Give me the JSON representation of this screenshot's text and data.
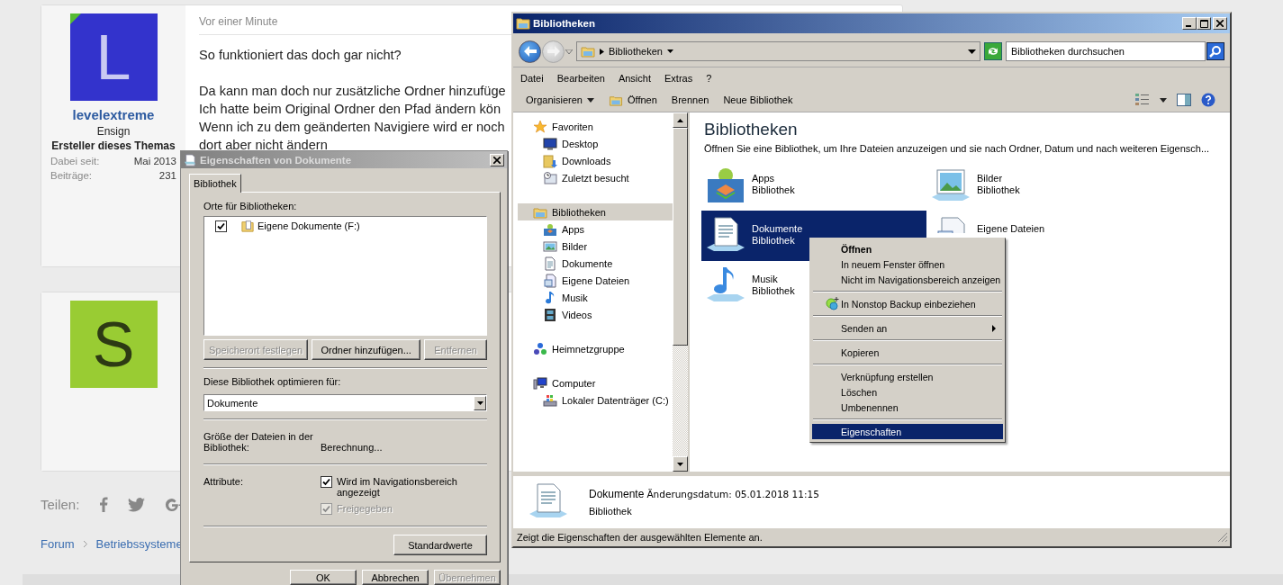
{
  "forum": {
    "posts": [
      {
        "avatar": {
          "letter": "L",
          "color": "#3333cc",
          "badge": true
        },
        "author": "levelextreme",
        "rank": "Ensign",
        "role": "Ersteller dieses Themas",
        "stats": [
          {
            "label": "Dabei seit:",
            "value": "Mai 2013"
          },
          {
            "label": "Beiträge:",
            "value": "231"
          }
        ],
        "time": "Vor einer Minute",
        "paragraphs": [
          [
            "So funktioniert das doch gar nicht?"
          ],
          [
            "Da kann man doch nur zusätzliche Ordner hinzufüge",
            "Ich hatte beim Original Ordner den Pfad ändern kön",
            "Wenn ich zu dem geänderten Navigiere wird er noch",
            "dort aber nicht ändern"
          ]
        ]
      },
      {
        "avatar": {
          "letter": "S",
          "color": "#99cc33",
          "badge": false
        }
      }
    ],
    "share": {
      "label": "Teilen:"
    },
    "breadcrumb": [
      "Forum",
      "Betriebssysteme"
    ]
  },
  "properties_dialog": {
    "title": "Eigenschaften von Dokumente",
    "tabs": [
      {
        "label": "Bibliothek",
        "selected": true
      }
    ],
    "locations_label": "Orte für Bibliotheken:",
    "locations": [
      {
        "name": "Eigene Dokumente (F:)",
        "checked": true
      }
    ],
    "location_buttons": [
      {
        "label": "Speicherort festlegen",
        "disabled": true
      },
      {
        "label": "Ordner hinzufügen...",
        "disabled": false
      },
      {
        "label": "Entfernen",
        "disabled": true
      }
    ],
    "optimize_label": "Diese Bibliothek optimieren für:",
    "optimize_value": "Dokumente",
    "size_label": "Größe der Dateien in der Bibliothek:",
    "size_value": "Berechnung...",
    "attributes_label": "Attribute:",
    "attributes": [
      {
        "label": "Wird im Navigationsbereich angezeigt",
        "checked": true,
        "disabled": false
      },
      {
        "label": "Freigegeben",
        "checked": true,
        "disabled": true
      }
    ],
    "defaults_button": "Standardwerte",
    "buttons": [
      {
        "label": "OK",
        "disabled": false
      },
      {
        "label": "Abbrechen",
        "disabled": false
      },
      {
        "label": "Übernehmen",
        "disabled": true
      }
    ]
  },
  "explorer": {
    "title": "Bibliotheken",
    "address": [
      "Bibliotheken"
    ],
    "search": {
      "placeholder": "Bibliotheken durchsuchen"
    },
    "menu": [
      "Datei",
      "Bearbeiten",
      "Ansicht",
      "Extras",
      "?"
    ],
    "toolbar": [
      {
        "label": "Organisieren",
        "kind": "dropdown"
      },
      {
        "label": "Öffnen",
        "kind": "folder"
      },
      {
        "label": "Brennen",
        "kind": "plain"
      },
      {
        "label": "Neue Bibliothek",
        "kind": "plain"
      }
    ],
    "nav": [
      {
        "label": "Favoriten",
        "kind": "star",
        "selected": false,
        "children": [
          {
            "label": "Desktop",
            "kind": "desktop",
            "selected": false
          },
          {
            "label": "Downloads",
            "kind": "downloads",
            "selected": false
          },
          {
            "label": "Zuletzt besucht",
            "kind": "recent",
            "selected": false
          }
        ]
      },
      {
        "label": "Bibliotheken",
        "kind": "library",
        "selected": true,
        "children": [
          {
            "label": "Apps",
            "kind": "apps",
            "selected": false
          },
          {
            "label": "Bilder",
            "kind": "pictures",
            "selected": false
          },
          {
            "label": "Dokumente",
            "kind": "documents",
            "selected": false
          },
          {
            "label": "Eigene Dateien",
            "kind": "files",
            "selected": false
          },
          {
            "label": "Musik",
            "kind": "music",
            "selected": false
          },
          {
            "label": "Videos",
            "kind": "videos",
            "selected": false
          }
        ]
      },
      {
        "label": "Heimnetzgruppe",
        "kind": "network",
        "selected": false
      },
      {
        "label": "Computer",
        "kind": "computer",
        "selected": false,
        "children": [
          {
            "label": "Lokaler Datenträger (C:)",
            "kind": "drive",
            "selected": false
          }
        ]
      }
    ],
    "heading": "Bibliotheken",
    "description": "Öffnen Sie eine Bibliothek, um Ihre Dateien anzuzeigen und sie nach Ordner, Datum und nach weiteren Eigensch...",
    "libraries": [
      {
        "name": "Apps",
        "type": "Bibliothek",
        "kind": "apps",
        "selected": false
      },
      {
        "name": "Bilder",
        "type": "Bibliothek",
        "kind": "pictures",
        "selected": false
      },
      {
        "name": "Dokumente",
        "type": "Bibliothek",
        "kind": "documents",
        "selected": true
      },
      {
        "name": "Eigene Dateien",
        "kind": "files",
        "selected": false
      },
      {
        "name": "Musik",
        "type": "Bibliothek",
        "kind": "music",
        "selected": false
      }
    ],
    "context_menu": [
      [
        {
          "label": "Öffnen",
          "kind": "plain",
          "bold": true,
          "submenu": false,
          "selected": false
        },
        {
          "label": "In neuem Fenster öffnen",
          "kind": "plain",
          "bold": false,
          "submenu": false,
          "selected": false
        },
        {
          "label": "Nicht im Navigationsbereich anzeigen",
          "kind": "plain",
          "bold": false,
          "submenu": false,
          "selected": false
        }
      ],
      [
        {
          "label": "In Nonstop Backup einbeziehen",
          "kind": "backup",
          "bold": false,
          "submenu": false,
          "selected": false
        }
      ],
      [
        {
          "label": "Senden an",
          "kind": "plain",
          "bold": false,
          "submenu": true,
          "selected": false
        }
      ],
      [
        {
          "label": "Kopieren",
          "kind": "plain",
          "bold": false,
          "submenu": false,
          "selected": false
        }
      ],
      [
        {
          "label": "Verknüpfung erstellen",
          "kind": "plain",
          "bold": false,
          "submenu": false,
          "selected": false
        },
        {
          "label": "Löschen",
          "kind": "plain",
          "bold": false,
          "submenu": false,
          "selected": false
        },
        {
          "label": "Umbenennen",
          "kind": "plain",
          "bold": false,
          "submenu": false,
          "selected": false
        }
      ],
      [
        {
          "label": "Eigenschaften",
          "kind": "plain",
          "bold": false,
          "submenu": false,
          "selected": true
        }
      ]
    ],
    "details": {
      "name": "Dokumente",
      "date": "Änderungsdatum: 05.01.2018 11:15",
      "type": "Bibliothek"
    },
    "status": "Zeigt die Eigenschaften der ausgewählten Elemente an."
  }
}
